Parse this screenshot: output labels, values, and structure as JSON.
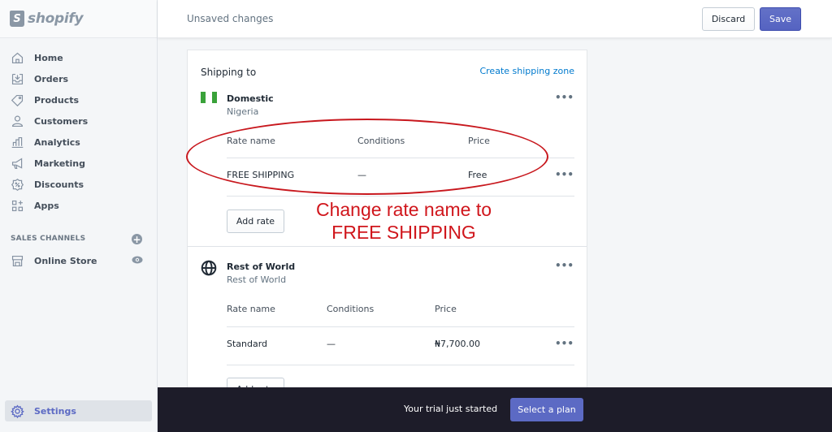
{
  "brand": {
    "name": "shopify",
    "icon": "shopping-bag-icon"
  },
  "sidebar": {
    "items": [
      {
        "label": "Home",
        "icon": "home-icon"
      },
      {
        "label": "Orders",
        "icon": "orders-inbox-icon"
      },
      {
        "label": "Products",
        "icon": "tag-icon"
      },
      {
        "label": "Customers",
        "icon": "person-icon"
      },
      {
        "label": "Analytics",
        "icon": "bar-chart-icon"
      },
      {
        "label": "Marketing",
        "icon": "megaphone-icon"
      },
      {
        "label": "Discounts",
        "icon": "discount-badge-icon"
      },
      {
        "label": "Apps",
        "icon": "apps-grid-icon"
      }
    ],
    "sales_channels_label": "SALES CHANNELS",
    "sales_channels_add": "+",
    "online_store": {
      "label": "Online Store",
      "icon": "store-icon",
      "action_icon": "eye-icon"
    },
    "settings": {
      "label": "Settings",
      "icon": "gear-icon"
    }
  },
  "topbar": {
    "title": "Unsaved changes",
    "discard_label": "Discard",
    "save_label": "Save"
  },
  "shipping": {
    "title": "Shipping to",
    "create_zone_link": "Create shipping zone",
    "zones": [
      {
        "name": "Domestic",
        "sub": "Nigeria",
        "icon": "nigeria-flag-icon",
        "more": "•••",
        "headers": [
          "Rate name",
          "Conditions",
          "Price"
        ],
        "rates": [
          {
            "name": "FREE SHIPPING",
            "conditions": "—",
            "price": "Free",
            "more": "•••"
          }
        ],
        "add_rate_label": "Add rate"
      },
      {
        "name": "Rest of World",
        "sub": "Rest of World",
        "icon": "globe-icon",
        "more": "•••",
        "headers": [
          "Rate name",
          "Conditions",
          "Price"
        ],
        "rates": [
          {
            "name": "Standard",
            "conditions": "—",
            "price": "₦7,700.00",
            "more": "•••"
          }
        ],
        "add_rate_label": "Add rate"
      }
    ]
  },
  "annotation": {
    "text_line1": "Change rate name to",
    "text_line2": "FREE SHIPPING",
    "color": "#d0161c"
  },
  "footer": {
    "message": "Your trial just started",
    "button_label": "Select a plan"
  },
  "colors": {
    "accent": "#5c6ac4",
    "link": "#007ace",
    "flag_green": "#3aa23a",
    "footer_bg": "#1d1c29"
  }
}
